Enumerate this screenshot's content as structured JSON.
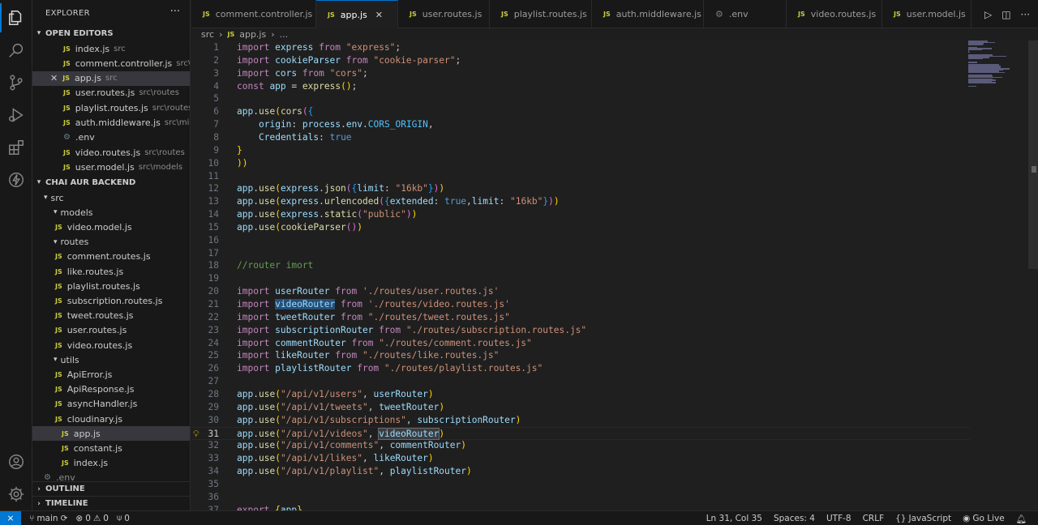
{
  "explorer": {
    "title": "EXPLORER",
    "more": "···",
    "open_editors_label": "OPEN EDITORS",
    "open_editors": [
      {
        "name": "index.js",
        "desc": "src",
        "icon": "js"
      },
      {
        "name": "comment.controller.js",
        "desc": "src\\c...",
        "icon": "js"
      },
      {
        "name": "app.js",
        "desc": "src",
        "icon": "js",
        "selected": true
      },
      {
        "name": "user.routes.js",
        "desc": "src\\routes",
        "icon": "js"
      },
      {
        "name": "playlist.routes.js",
        "desc": "src\\routes",
        "icon": "js"
      },
      {
        "name": "auth.middleware.js",
        "desc": "src\\midd...",
        "icon": "js"
      },
      {
        "name": ".env",
        "desc": "",
        "icon": "gear"
      },
      {
        "name": "video.routes.js",
        "desc": "src\\routes",
        "icon": "js"
      },
      {
        "name": "user.model.js",
        "desc": "src\\models",
        "icon": "js"
      }
    ],
    "project_label": "CHAI AUR BACKEND",
    "tree": [
      {
        "name": "src",
        "type": "folder"
      },
      {
        "name": "models",
        "type": "folder"
      },
      {
        "name": "video.model.js",
        "type": "file"
      },
      {
        "name": "routes",
        "type": "folder"
      },
      {
        "name": "comment.routes.js",
        "type": "file"
      },
      {
        "name": "like.routes.js",
        "type": "file"
      },
      {
        "name": "playlist.routes.js",
        "type": "file"
      },
      {
        "name": "subscription.routes.js",
        "type": "file"
      },
      {
        "name": "tweet.routes.js",
        "type": "file"
      },
      {
        "name": "user.routes.js",
        "type": "file"
      },
      {
        "name": "video.routes.js",
        "type": "file"
      },
      {
        "name": "utils",
        "type": "folder"
      },
      {
        "name": "ApiError.js",
        "type": "file"
      },
      {
        "name": "ApiResponse.js",
        "type": "file"
      },
      {
        "name": "asyncHandler.js",
        "type": "file"
      },
      {
        "name": "cloudinary.js",
        "type": "file"
      },
      {
        "name": "app.js",
        "type": "file",
        "selected": true
      },
      {
        "name": "constant.js",
        "type": "file"
      },
      {
        "name": "index.js",
        "type": "file"
      },
      {
        "name": ".env",
        "type": "gear"
      }
    ],
    "outline_label": "OUTLINE",
    "timeline_label": "TIMELINE"
  },
  "tabs": [
    {
      "label": "comment.controller.js",
      "icon": "js"
    },
    {
      "label": "app.js",
      "icon": "js",
      "active": true,
      "close": "✕"
    },
    {
      "label": "user.routes.js",
      "icon": "js"
    },
    {
      "label": "playlist.routes.js",
      "icon": "js"
    },
    {
      "label": "auth.middleware.js",
      "icon": "js"
    },
    {
      "label": ".env",
      "icon": "gear"
    },
    {
      "label": "video.routes.js",
      "icon": "js"
    },
    {
      "label": "user.model.js",
      "icon": "js"
    }
  ],
  "breadcrumb": {
    "folder": "src",
    "file": "app.js",
    "more": "..."
  },
  "editor": {
    "current_line": 31,
    "lines": [
      {
        "n": "1",
        "code": "import express from \"express\";"
      },
      {
        "n": "2",
        "code": "import cookieParser from \"cookie-parser\";"
      },
      {
        "n": "3",
        "code": "import cors from \"cors\";"
      },
      {
        "n": "4",
        "code": "const app = express();"
      },
      {
        "n": "5",
        "code": ""
      },
      {
        "n": "6",
        "code": "app.use(cors({"
      },
      {
        "n": "7",
        "code": "    origin: process.env.CORS_ORIGIN,"
      },
      {
        "n": "8",
        "code": "    Credentials: true"
      },
      {
        "n": "9",
        "code": "}"
      },
      {
        "n": "10",
        "code": "))"
      },
      {
        "n": "11",
        "code": ""
      },
      {
        "n": "12",
        "code": "app.use(express.json({limit: \"16kb\"}))"
      },
      {
        "n": "13",
        "code": "app.use(express.urlencoded({extended: true,limit: \"16kb\"}))"
      },
      {
        "n": "14",
        "code": "app.use(express.static(\"public\"))"
      },
      {
        "n": "15",
        "code": "app.use(cookieParser())"
      },
      {
        "n": "16",
        "code": ""
      },
      {
        "n": "17",
        "code": ""
      },
      {
        "n": "18",
        "code": "//router imort"
      },
      {
        "n": "19",
        "code": ""
      },
      {
        "n": "20",
        "code": "import userRouter from './routes/user.routes.js'"
      },
      {
        "n": "21",
        "code": "import videoRouter from './routes/video.routes.js'"
      },
      {
        "n": "22",
        "code": "import tweetRouter from \"./routes/tweet.routes.js\""
      },
      {
        "n": "23",
        "code": "import subscriptionRouter from \"./routes/subscription.routes.js\""
      },
      {
        "n": "24",
        "code": "import commentRouter from \"./routes/comment.routes.js\""
      },
      {
        "n": "25",
        "code": "import likeRouter from \"./routes/like.routes.js\""
      },
      {
        "n": "26",
        "code": "import playlistRouter from \"./routes/playlist.routes.js\""
      },
      {
        "n": "27",
        "code": ""
      },
      {
        "n": "28",
        "code": "app.use(\"/api/v1/users\", userRouter)"
      },
      {
        "n": "29",
        "code": "app.use(\"/api/v1/tweets\", tweetRouter)"
      },
      {
        "n": "30",
        "code": "app.use(\"/api/v1/subscriptions\", subscriptionRouter)"
      },
      {
        "n": "31",
        "code": "app.use(\"/api/v1/videos\", videoRouter)"
      },
      {
        "n": "32",
        "code": "app.use(\"/api/v1/comments\", commentRouter)"
      },
      {
        "n": "33",
        "code": "app.use(\"/api/v1/likes\", likeRouter)"
      },
      {
        "n": "34",
        "code": "app.use(\"/api/v1/playlist\", playlistRouter)"
      },
      {
        "n": "35",
        "code": ""
      },
      {
        "n": "36",
        "code": ""
      },
      {
        "n": "37",
        "code": "export {app}"
      }
    ]
  },
  "statusbar": {
    "branch": "main",
    "errors": "0",
    "warnings": "0",
    "ports": "0",
    "position": "Ln 31, Col 35",
    "spaces": "Spaces: 4",
    "encoding": "UTF-8",
    "eol": "CRLF",
    "language": "JavaScript",
    "golive": "Go Live"
  },
  "colors": {
    "accent": "#0078d4",
    "js_icon": "#cbcb41",
    "keyword": "#c586c0",
    "string": "#ce9178",
    "variable": "#9cdcfe",
    "function": "#dcdcaa",
    "comment": "#6a9955"
  }
}
